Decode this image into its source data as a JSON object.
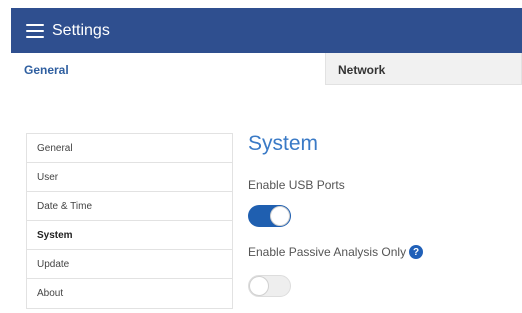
{
  "appbar": {
    "title": "Settings",
    "icon": "menu-icon"
  },
  "tabs": [
    {
      "label": "General",
      "active": true
    },
    {
      "label": "Network",
      "active": false
    }
  ],
  "sidenav": {
    "items": [
      {
        "label": "General"
      },
      {
        "label": "User"
      },
      {
        "label": "Date & Time"
      },
      {
        "label": "System",
        "active": true
      },
      {
        "label": "Update"
      },
      {
        "label": "About"
      }
    ]
  },
  "content": {
    "title": "System",
    "usb": {
      "label": "Enable USB Ports",
      "enabled": true
    },
    "passive": {
      "label": "Enable Passive Analysis Only",
      "enabled": false,
      "help_icon": "question-circle-icon",
      "help_glyph": "?"
    }
  },
  "colors": {
    "appbar": "#2f4f8f",
    "accent": "#3a7ac6",
    "toggle_on": "#1f5fb0"
  }
}
